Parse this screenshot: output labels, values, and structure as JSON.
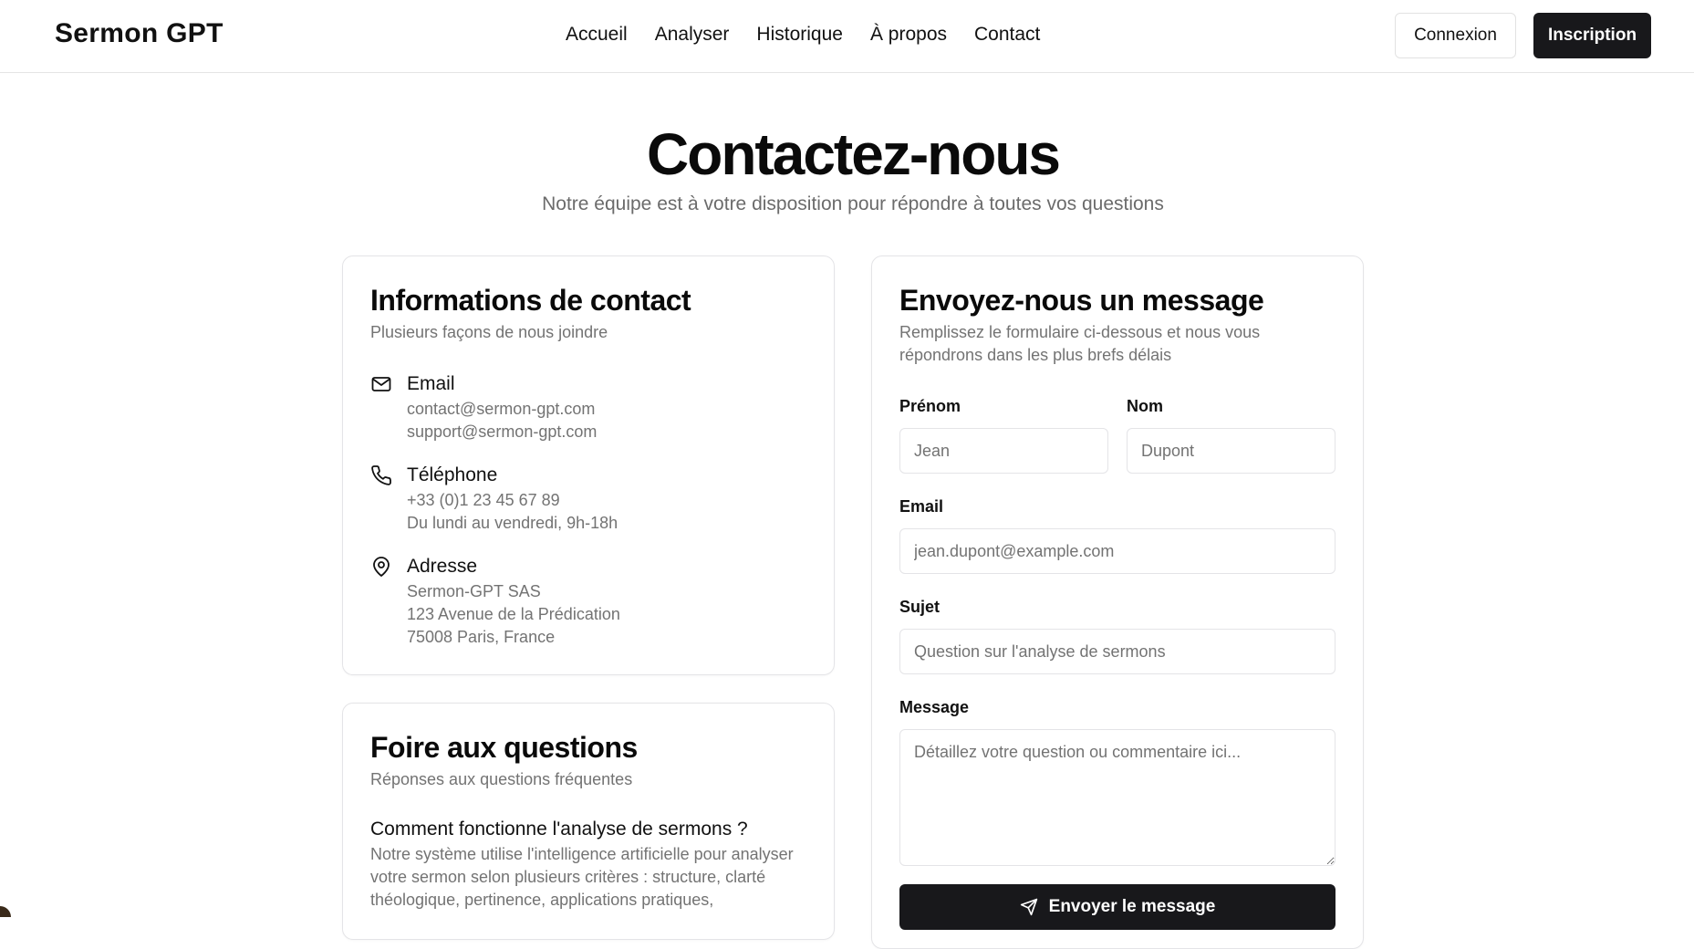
{
  "header": {
    "brand": "Sermon GPT",
    "nav": [
      "Accueil",
      "Analyser",
      "Historique",
      "À propos",
      "Contact"
    ],
    "login_label": "Connexion",
    "signup_label": "Inscription"
  },
  "hero": {
    "title": "Contactez-nous",
    "subtitle": "Notre équipe est à votre disposition pour répondre à toutes vos questions"
  },
  "contact_card": {
    "title": "Informations de contact",
    "description": "Plusieurs façons de nous joindre",
    "email": {
      "icon": "mail-icon",
      "heading": "Email",
      "lines": [
        "contact@sermon-gpt.com",
        "support@sermon-gpt.com"
      ]
    },
    "phone": {
      "icon": "phone-icon",
      "heading": "Téléphone",
      "lines": [
        "+33 (0)1 23 45 67 89",
        "Du lundi au vendredi, 9h-18h"
      ]
    },
    "address": {
      "icon": "map-pin-icon",
      "heading": "Adresse",
      "lines": [
        "Sermon-GPT SAS",
        "123 Avenue de la Prédication",
        "75008 Paris, France"
      ]
    }
  },
  "faq_card": {
    "title": "Foire aux questions",
    "description": "Réponses aux questions fréquentes",
    "question": "Comment fonctionne l'analyse de sermons ?",
    "answer": "Notre système utilise l'intelligence artificielle pour analyser votre sermon selon plusieurs critères : structure, clarté théologique, pertinence, applications pratiques,"
  },
  "form_card": {
    "title": "Envoyez-nous un message",
    "description": "Remplissez le formulaire ci-dessous et nous vous répondrons dans les plus brefs délais",
    "first_name_label": "Prénom",
    "first_name_placeholder": "Jean",
    "last_name_label": "Nom",
    "last_name_placeholder": "Dupont",
    "email_label": "Email",
    "email_placeholder": "jean.dupont@example.com",
    "subject_label": "Sujet",
    "subject_placeholder": "Question sur l'analyse de sermons",
    "message_label": "Message",
    "message_placeholder": "Détaillez votre question ou commentaire ici...",
    "submit_label": "Envoyer le message",
    "submit_icon": "send-icon"
  }
}
